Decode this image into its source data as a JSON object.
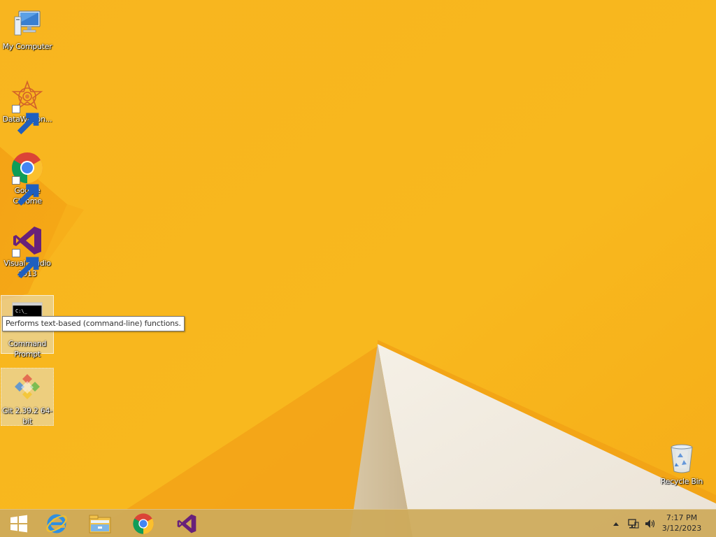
{
  "desktop": {
    "icons": [
      {
        "name": "my-computer",
        "label": "My Computer",
        "shortcut": false,
        "selected": false
      },
      {
        "name": "datawagon",
        "label": "DataWagon...",
        "shortcut": true,
        "selected": false
      },
      {
        "name": "google-chrome",
        "label": "Google Chrome",
        "shortcut": true,
        "selected": false
      },
      {
        "name": "visual-studio-2013",
        "label": "Visual Studio 2013",
        "shortcut": true,
        "selected": false
      },
      {
        "name": "command-prompt",
        "label": "Command Prompt",
        "shortcut": false,
        "selected": true
      },
      {
        "name": "git",
        "label": "Git 2.39.2 64-bit",
        "shortcut": false,
        "selected": true
      },
      {
        "name": "recycle-bin",
        "label": "Recycle Bin",
        "shortcut": false,
        "selected": false
      }
    ],
    "tooltip": "Performs text-based (command-line) functions."
  },
  "taskbar": {
    "start": "start-button",
    "pinned": [
      "internet-explorer-icon",
      "file-explorer-icon",
      "chrome-icon",
      "visual-studio-icon"
    ],
    "tray_icons": [
      "show-hidden-icons-icon",
      "network-icon",
      "volume-icon"
    ],
    "clock": {
      "time": "7:17 PM",
      "date": "3/12/2023"
    }
  },
  "colors": {
    "wallpaper_base": "#f7b31c",
    "wallpaper_dark": "#f09a12",
    "wallpaper_white": "#f2ebe0",
    "taskbar": "#cdaa5a"
  }
}
